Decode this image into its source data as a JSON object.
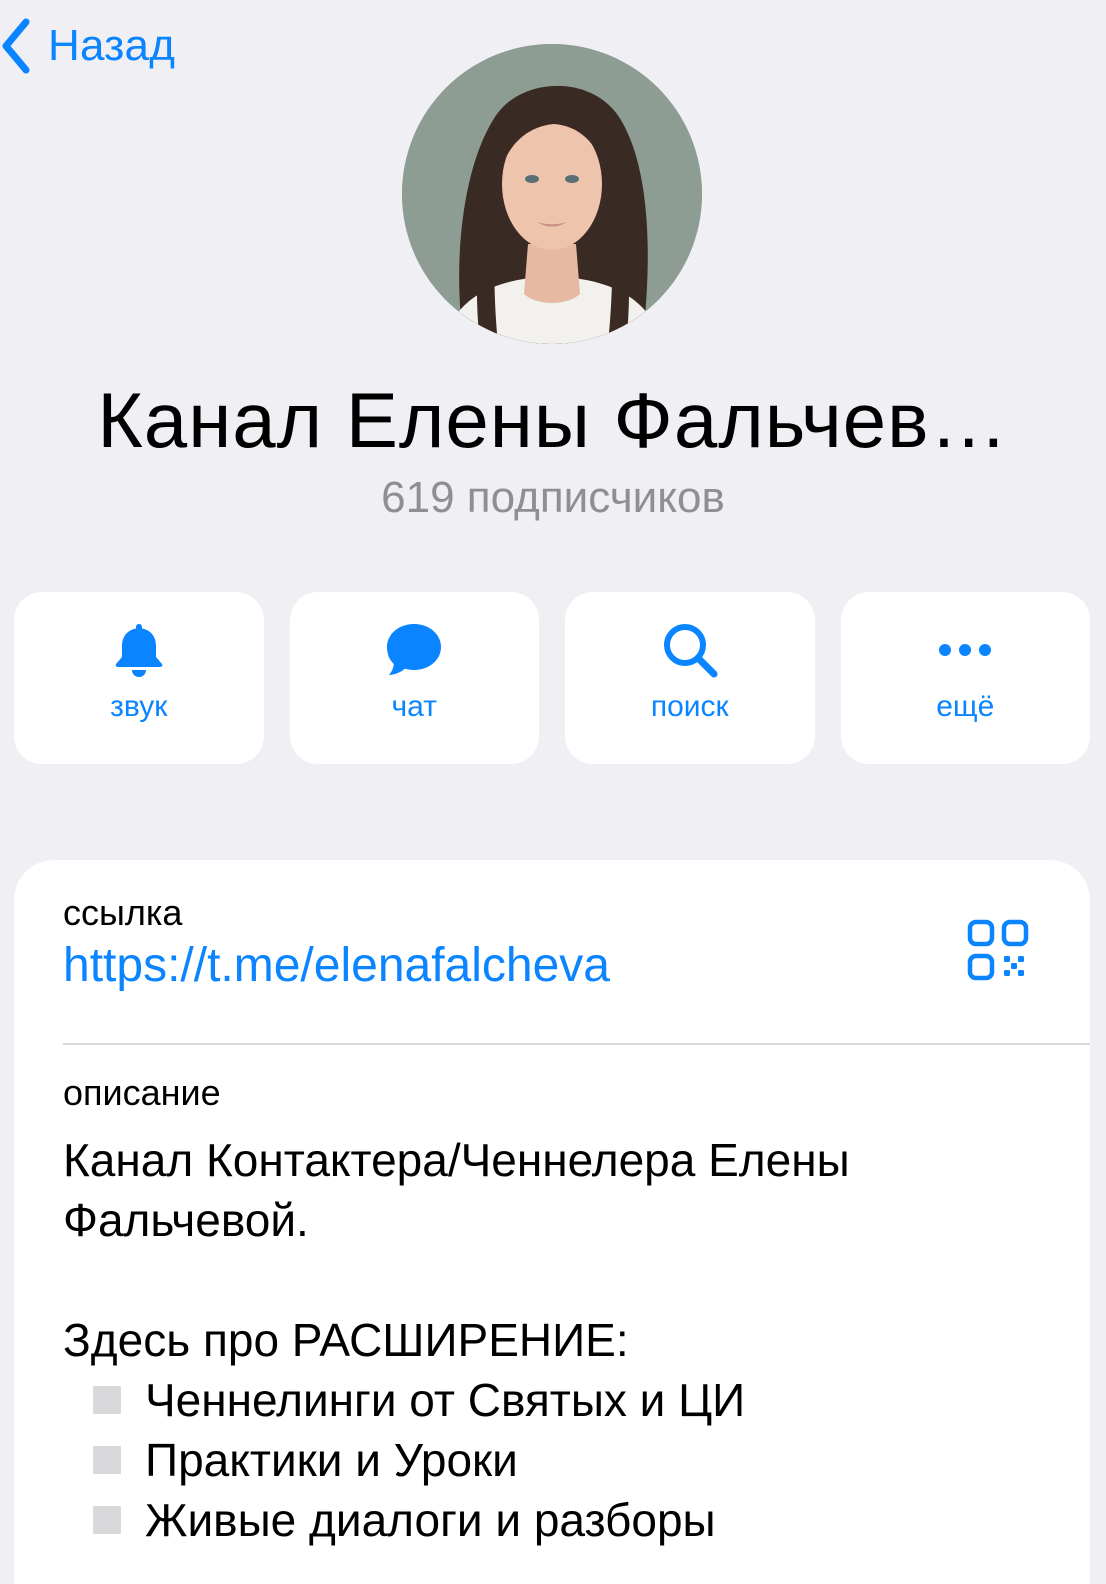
{
  "nav": {
    "back_label": "Назад"
  },
  "channel": {
    "title": "Канал Елены Фальчев…",
    "subscribers": "619 подписчиков"
  },
  "actions": [
    {
      "label": "звук",
      "icon": "bell-icon"
    },
    {
      "label": "чат",
      "icon": "chat-bubble-icon"
    },
    {
      "label": "поиск",
      "icon": "search-icon"
    },
    {
      "label": "ещё",
      "icon": "more-dots-icon"
    }
  ],
  "info": {
    "link_label": "ссылка",
    "link": "https://t.me/elenafalcheva",
    "description_label": "описание",
    "description_intro": "Канал Контактера/Ченнелера Елены Фальчевой.",
    "description_heading": "Здесь про РАСШИРЕНИЕ:",
    "description_items": [
      "Ченнелинги от Святых и ЦИ",
      "Практики и Уроки",
      "Живые диалоги и разборы"
    ]
  },
  "colors": {
    "accent": "#0a84ff",
    "background": "#efeff4",
    "secondary_text": "#8e8e93"
  }
}
